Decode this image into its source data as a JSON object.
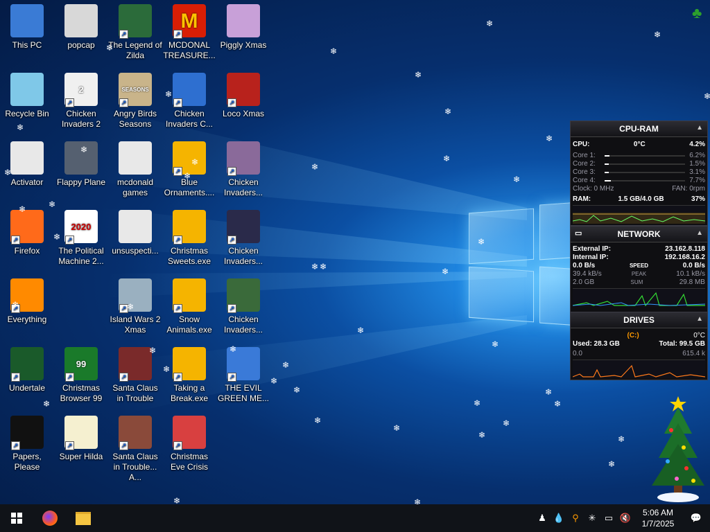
{
  "desktop": {
    "icons": [
      {
        "label": "This PC"
      },
      {
        "label": "popcap"
      },
      {
        "label": "The Legend of Zilda"
      },
      {
        "label": "MCDONAL TREASURE..."
      },
      {
        "label": "Piggly Xmas"
      },
      {
        "label": "Recycle Bin"
      },
      {
        "label": "Chicken Invaders 2"
      },
      {
        "label": "Angry Birds Seasons"
      },
      {
        "label": "Chicken Invaders C..."
      },
      {
        "label": "Loco Xmas"
      },
      {
        "label": "Activator"
      },
      {
        "label": "Flappy Plane"
      },
      {
        "label": "mcdonald games"
      },
      {
        "label": "Blue Ornaments...."
      },
      {
        "label": "Chicken Invaders..."
      },
      {
        "label": "Firefox"
      },
      {
        "label": "The Political Machine 2..."
      },
      {
        "label": "unsuspecti..."
      },
      {
        "label": "Christmas Sweets.exe"
      },
      {
        "label": "Chicken Invaders..."
      },
      {
        "label": "Everything"
      },
      {
        "label": "Island Wars 2 Xmas"
      },
      {
        "label": "Snow Animals.exe"
      },
      {
        "label": "Chicken Invaders..."
      },
      {
        "label": "Undertale"
      },
      {
        "label": "Christmas Browser 99"
      },
      {
        "label": "Santa Claus in Trouble"
      },
      {
        "label": "Taking a Break.exe"
      },
      {
        "label": "THE EVIL GREEN ME..."
      },
      {
        "label": "Papers, Please"
      },
      {
        "label": "Super Hilda"
      },
      {
        "label": "Santa Claus in Trouble... A..."
      },
      {
        "label": "Christmas Eve Crisis"
      }
    ],
    "icon_badges": {
      "political": "2020",
      "chicken2": "2",
      "browser": "99",
      "mcd": "M",
      "angry": "SEASONS"
    }
  },
  "cpu_ram": {
    "title": "CPU-RAM",
    "cpu_label": "CPU:",
    "cpu_temp": "0°C",
    "cpu_value": "4.2%",
    "cores": [
      {
        "label": "Core 1:",
        "value": "6.2%",
        "fill": 0.06
      },
      {
        "label": "Core 2:",
        "value": "1.5%",
        "fill": 0.015
      },
      {
        "label": "Core 3:",
        "value": "3.1%",
        "fill": 0.03
      },
      {
        "label": "Core 4:",
        "value": "7.7%",
        "fill": 0.08
      }
    ],
    "clock": "Clock: 0 MHz",
    "fan": "FAN: 0rpm",
    "ram_label": "RAM:",
    "ram_value": "1.5 GB/4.0 GB",
    "ram_percent": "37%"
  },
  "network": {
    "title": "NETWORK",
    "external_label": "External IP:",
    "external_ip": "23.162.8.118",
    "internal_label": "Internal IP:",
    "internal_ip": "192.168.16.2",
    "speed_down": "0.0 B/s",
    "speed_label": "SPEED",
    "speed_up": "0.0 B/s",
    "peak_down": "39.4 kB/s",
    "peak_label": "PEAK",
    "peak_up": "10.1 kB/s",
    "sum_down": "2.0 GB",
    "sum_label": "SUM",
    "sum_up": "29.8 MB"
  },
  "drives": {
    "title": "DRIVES",
    "drive_letter": "(C:)",
    "temp": "0°C",
    "used": "Used: 28.3 GB",
    "total": "Total: 99.5 GB",
    "read": "0.0",
    "write": "615.4 k"
  },
  "taskbar": {
    "time": "5:06 AM",
    "date": "1/7/2025"
  },
  "colors": {
    "accent": "#0a78d7",
    "taskbar": "#101318",
    "gadget_bg": "#0f0f12"
  }
}
